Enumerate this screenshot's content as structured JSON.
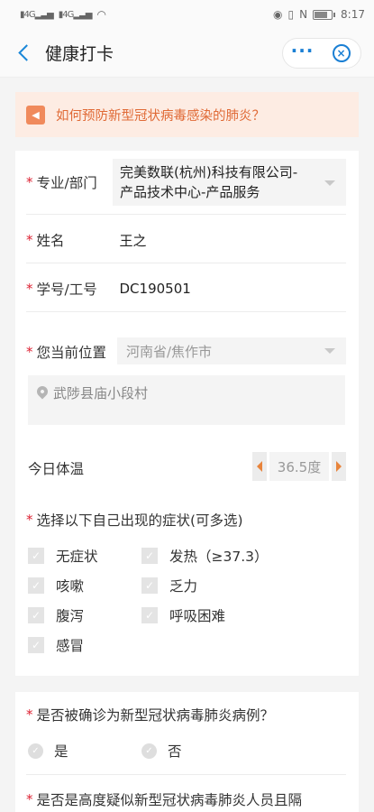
{
  "statusbar": {
    "left_signal_1": "4G",
    "left_signal_2": "4G",
    "time": "8:17",
    "nfc": "N"
  },
  "header": {
    "title": "健康打卡",
    "more_label": "···",
    "close_label": "×"
  },
  "notice": {
    "text": "如何预防新型冠状病毒感染的肺炎？"
  },
  "form": {
    "department": {
      "label": "专业/部门",
      "value_line1": "完美数联(杭州)科技有限公司-",
      "value_line2": "产品技术中心-产品服务"
    },
    "name": {
      "label": "姓名",
      "value": "王之"
    },
    "id": {
      "label": "学号/工号",
      "value": "DC190501"
    },
    "location": {
      "label": "您当前位置",
      "value": "河南省/焦作市",
      "address": "武陟县庙小段村"
    },
    "temperature": {
      "label": "今日体温",
      "value": "36.5度"
    },
    "symptoms": {
      "label": "选择以下自己出现的症状(可多选)",
      "options": [
        "无症状",
        "发热（≥37.3）",
        "咳嗽",
        "乏力",
        "腹泻",
        "呼吸困难",
        "感冒"
      ]
    },
    "diagnosed": {
      "label": "是否被确诊为新型冠状病毒肺炎病例？",
      "options": [
        "是",
        "否"
      ]
    },
    "suspected": {
      "label": "是否是高度疑似新型冠状病毒肺炎人员且隔"
    }
  },
  "colors": {
    "accent": "#1a87d8",
    "notice_bg": "#fdece3",
    "notice_text": "#e06a36",
    "required": "#dd2233",
    "stepper_arrow": "#e8843c"
  }
}
